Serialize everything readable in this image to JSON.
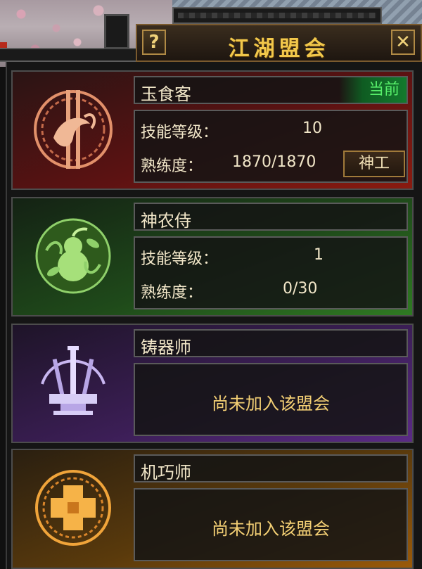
{
  "window": {
    "title": "江湖盟会",
    "help_label": "?",
    "close_label": "✕"
  },
  "guilds": [
    {
      "name": "玉食客",
      "status": "当前",
      "skill_label": "技能等级：",
      "skill_value": "10",
      "proficiency_label": "熟练度：",
      "proficiency_value": "1870/1870",
      "action_label": "神工",
      "emblem_icon": "koi-fish-icon",
      "theme_color": "#8a1b10"
    },
    {
      "name": "神农侍",
      "skill_label": "技能等级：",
      "skill_value": "1",
      "proficiency_label": "熟练度：",
      "proficiency_value": "0/30",
      "emblem_icon": "gourd-icon",
      "theme_color": "#2f7a22"
    },
    {
      "name": "铸器师",
      "not_joined": "尚未加入该盟会",
      "emblem_icon": "anvil-swords-icon",
      "theme_color": "#5a2a85"
    },
    {
      "name": "机巧师",
      "not_joined": "尚未加入该盟会",
      "emblem_icon": "gear-block-icon",
      "theme_color": "#9a5a0a"
    }
  ]
}
